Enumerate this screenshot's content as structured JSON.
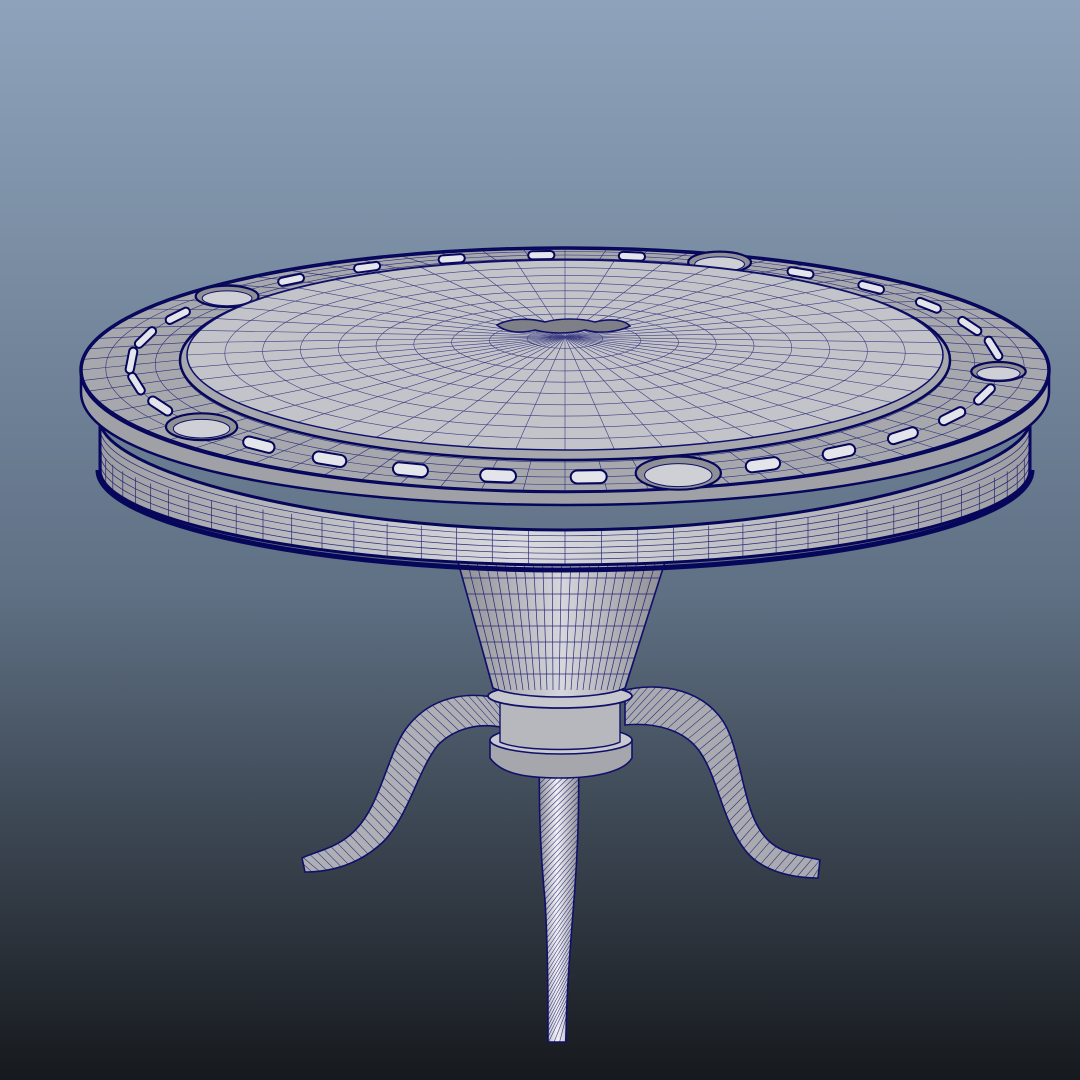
{
  "scene": {
    "subject": "wireframe-poker-table",
    "background_top_color": "#8ea3bb",
    "background_mid_color": "#5f7084",
    "background_bottom_color": "#16191d",
    "mesh_fill_color": "#b8b9bd",
    "mesh_light_color": "#e9eaee",
    "wire_color": "#10106a",
    "edge_color": "#06065a"
  }
}
